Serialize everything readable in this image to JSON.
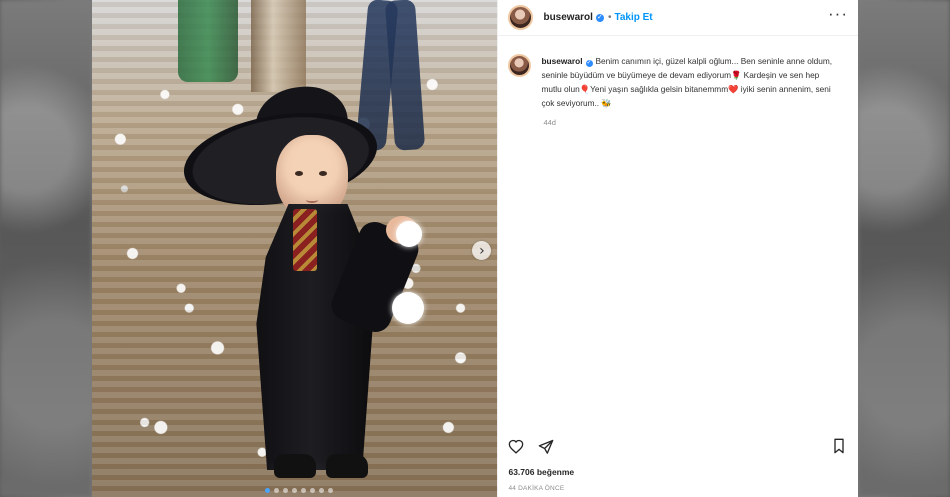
{
  "post": {
    "username": "busewarol",
    "follow_label": "Takip Et",
    "caption": "Benim canımın içi, güzel kalpli oğlum... Ben seninle anne oldum, seninle büyüdüm ve büyümeye de devam ediyorum🌹 Kardeşin ve sen hep mutlu olun🎈Yeni yaşın sağlıkla gelsin bitanemmm❤️ iyiki senin annenim, seni çok seviyorum.. 🐝",
    "posted_ago": "44d",
    "likes": "63.706 beğenme",
    "timestamp_label": "44 DAKİKA ÖNCE",
    "carousel_next_label": "›",
    "dots": [
      "active",
      "",
      "",
      "",
      "",
      "",
      "",
      ""
    ]
  },
  "icons": {
    "verified": "verified-badge-icon",
    "more": "more-options-icon",
    "like": "heart-icon",
    "share": "send-icon",
    "save": "bookmark-icon"
  },
  "colors": {
    "accent": "#0095f6",
    "verified": "#2d8cff",
    "text": "#262626",
    "muted": "#8e8e8e"
  }
}
